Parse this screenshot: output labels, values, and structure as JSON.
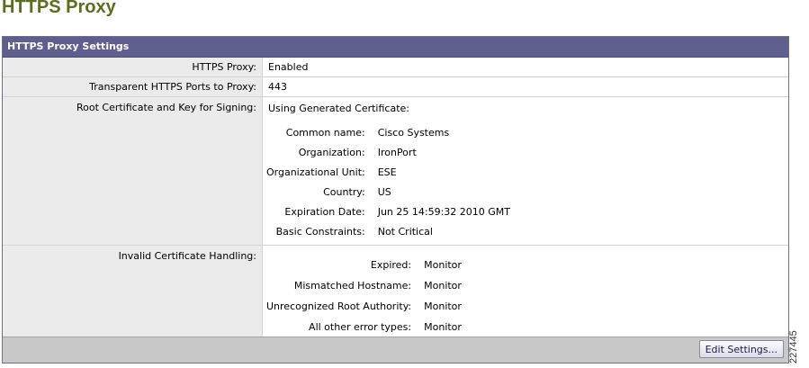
{
  "page": {
    "title": "HTTPS Proxy",
    "figure_id": "227445"
  },
  "panel": {
    "header": "HTTPS Proxy Settings",
    "rows": {
      "https_proxy": {
        "label": "HTTPS Proxy:",
        "value": "Enabled"
      },
      "transparent_ports": {
        "label": "Transparent HTTPS Ports to Proxy:",
        "value": "443"
      },
      "root_cert": {
        "label": "Root Certificate and Key for Signing:",
        "intro": "Using Generated Certificate:",
        "fields": [
          {
            "label": "Common name:",
            "value": "Cisco Systems"
          },
          {
            "label": "Organization:",
            "value": "IronPort"
          },
          {
            "label": "Organizational Unit:",
            "value": "ESE"
          },
          {
            "label": "Country:",
            "value": "US"
          },
          {
            "label": "Expiration Date:",
            "value": "Jun 25 14:59:32 2010 GMT"
          },
          {
            "label": "Basic Constraints:",
            "value": "Not Critical"
          }
        ]
      },
      "invalid_cert": {
        "label": "Invalid Certificate Handling:",
        "fields": [
          {
            "label": "Expired:",
            "value": "Monitor"
          },
          {
            "label": "Mismatched Hostname:",
            "value": "Monitor"
          },
          {
            "label": "Unrecognized Root Authority:",
            "value": "Monitor"
          },
          {
            "label": "All other error types:",
            "value": "Monitor"
          }
        ]
      }
    },
    "footer": {
      "edit_button_label": "Edit Settings..."
    }
  }
}
